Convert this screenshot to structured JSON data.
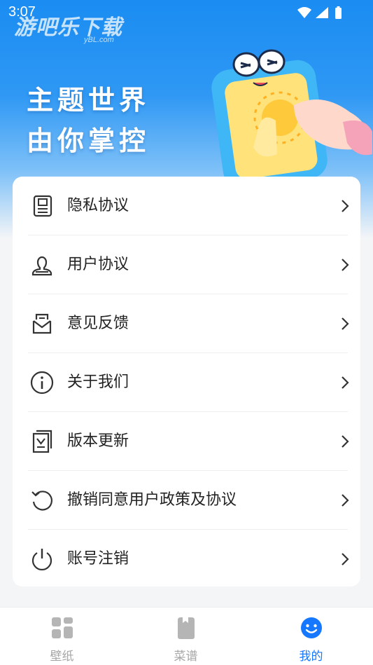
{
  "status_bar": {
    "time": "3:07"
  },
  "watermark": {
    "text": "游吧乐下载",
    "sub": "yBL.com"
  },
  "banner": {
    "line1": "主题世界",
    "line2": "由你掌控"
  },
  "menu": {
    "items": [
      {
        "label": "隐私协议",
        "icon": "document-icon"
      },
      {
        "label": "用户协议",
        "icon": "user-icon"
      },
      {
        "label": "意见反馈",
        "icon": "mail-icon"
      },
      {
        "label": "关于我们",
        "icon": "info-icon"
      },
      {
        "label": "版本更新",
        "icon": "update-icon"
      },
      {
        "label": "撤销同意用户政策及协议",
        "icon": "revoke-icon"
      },
      {
        "label": "账号注销",
        "icon": "power-icon"
      }
    ]
  },
  "tabbar": {
    "tabs": [
      {
        "label": "壁纸",
        "icon": "grid-icon",
        "active": false
      },
      {
        "label": "菜谱",
        "icon": "book-icon",
        "active": false
      },
      {
        "label": "我的",
        "icon": "smile-icon",
        "active": true
      }
    ]
  },
  "colors": {
    "accent": "#1677ff",
    "header": "#1a8cf2",
    "inactive": "#a6a6a6"
  }
}
